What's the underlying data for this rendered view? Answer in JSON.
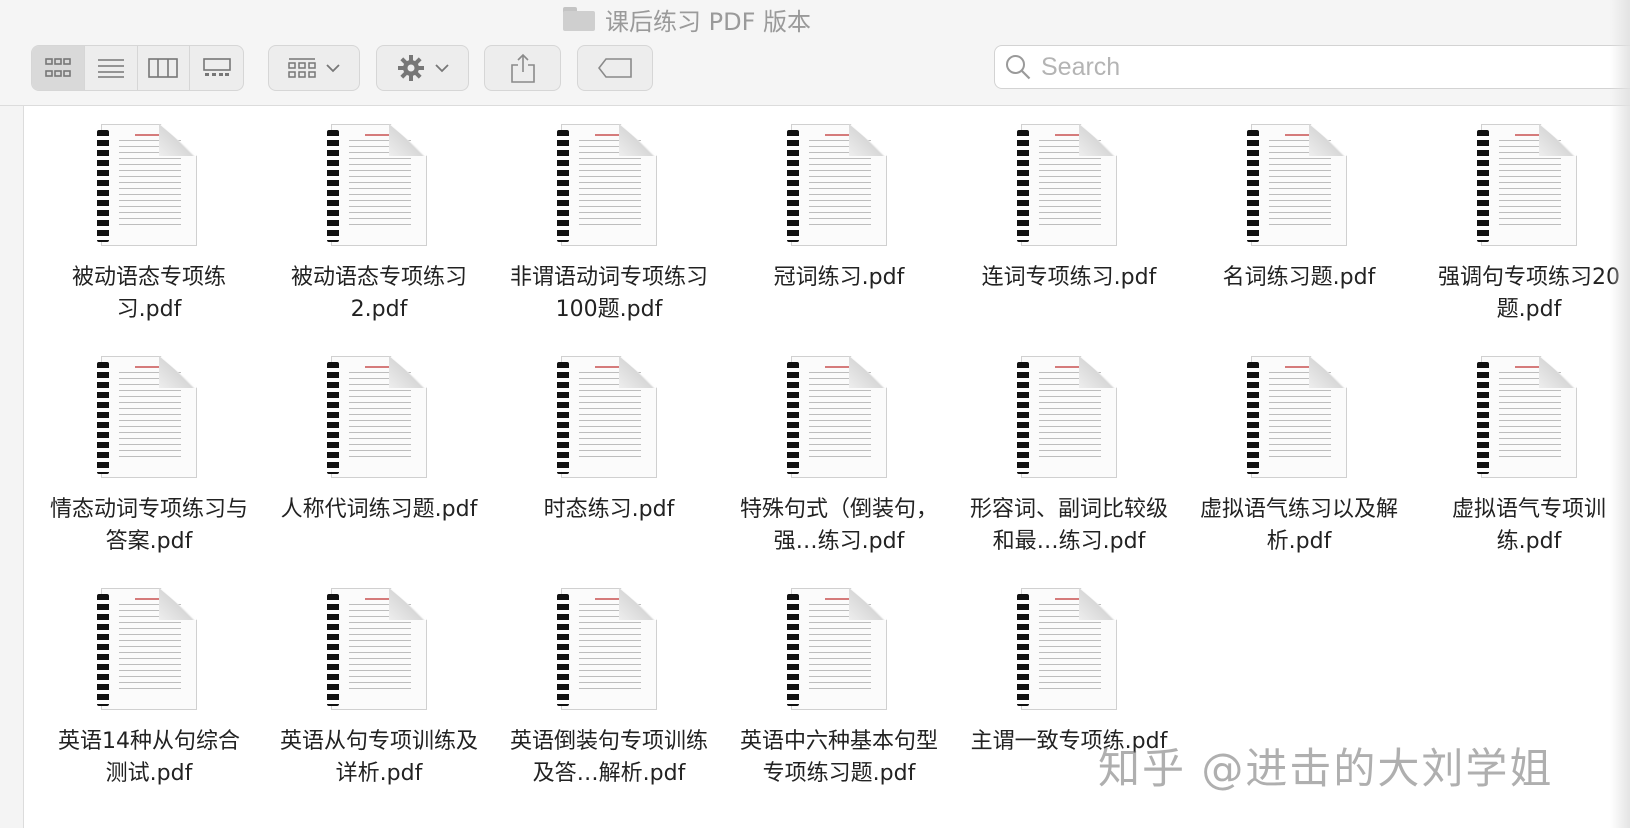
{
  "window": {
    "title": "课后练习 PDF 版本"
  },
  "toolbar": {
    "view_modes": [
      {
        "name": "icon-view-icon",
        "active": true
      },
      {
        "name": "list-view-icon",
        "active": false
      },
      {
        "name": "column-view-icon",
        "active": false
      },
      {
        "name": "gallery-view-icon",
        "active": false
      }
    ],
    "group_button_icon": "group-grid-icon",
    "action_button_icon": "gear-icon",
    "share_button_icon": "share-icon",
    "tag_button_icon": "tag-icon"
  },
  "search": {
    "placeholder": "Search",
    "value": ""
  },
  "files": [
    "被动语态专项练习.pdf",
    "被动语态专项练习2.pdf",
    "非谓语动词专项练习100题.pdf",
    "冠词练习.pdf",
    "连词专项练习.pdf",
    "名词练习题.pdf",
    "强调句专项练习20题.pdf",
    "情态动词专项练习与答案.pdf",
    "人称代词练习题.pdf",
    "时态练习.pdf",
    "特殊句式（倒装句，强…练习.pdf",
    "形容词、副词比较级和最…练习.pdf",
    "虚拟语气练习以及解析.pdf",
    "虚拟语气专项训练.pdf",
    "英语14种从句综合测试.pdf",
    "英语从句专项训练及详析.pdf",
    "英语倒装句专项训练及答…解析.pdf",
    "英语中六种基本句型专项练习题.pdf",
    "主谓一致专项练.pdf"
  ],
  "watermark": "知乎 @进击的大刘学姐"
}
